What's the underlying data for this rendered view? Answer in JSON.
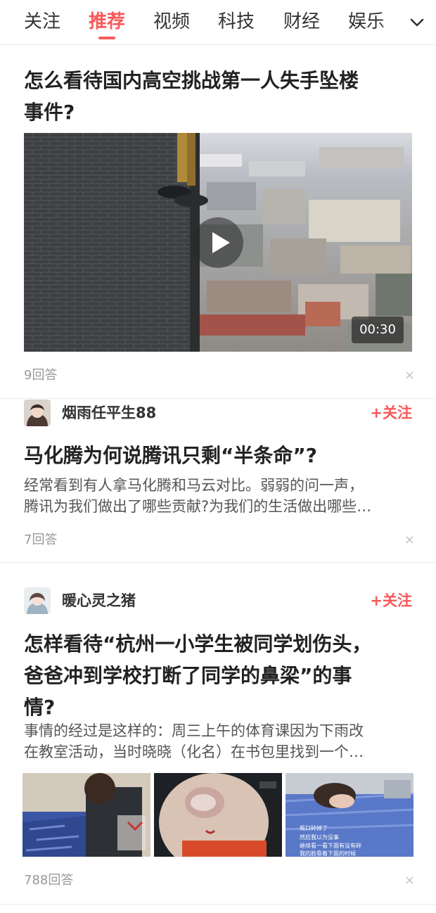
{
  "tabs": [
    {
      "label": "关注",
      "active": false
    },
    {
      "label": "推荐",
      "active": true
    },
    {
      "label": "视频",
      "active": false
    },
    {
      "label": "科技",
      "active": false
    },
    {
      "label": "财经",
      "active": false
    },
    {
      "label": "娱乐",
      "active": false
    }
  ],
  "more_icon": "chevron-down-icon",
  "accent_color": "#f85959",
  "feed": [
    {
      "title_lines": [
        "怎么看待国内高空挑战第一人失手坠楼",
        "事件?"
      ],
      "video": {
        "duration": "00:30",
        "icon": "play-icon"
      },
      "answers": "9回答",
      "dismiss": "×"
    },
    {
      "author": "烟雨任平生88",
      "follow_label": "+关注",
      "title_lines": [
        "马化腾为何说腾讯只剩“半条命”?"
      ],
      "excerpt_lines": [
        "经常看到有人拿马化腾和马云对比。弱弱的问一声，",
        "腾讯为我们做出了哪些贡献?为我们的生活做出哪些…"
      ],
      "answers": "7回答",
      "dismiss": "×"
    },
    {
      "author": "暖心灵之猪",
      "follow_label": "+关注",
      "title_lines": [
        "怎样看待“杭州一小学生被同学划伤头，",
        "爸爸冲到学校打断了同学的鼻梁”的事",
        "情?"
      ],
      "excerpt_lines": [
        "事情的经过是这样的：周三上午的体育课因为下雨改",
        "在教室活动，当时晓晓（化名）在书包里找到一个…"
      ],
      "thumb_captions": [
        "瓶口碎掉了",
        "然后我以为没事",
        "继续看一看下面有没有碎",
        "我的脸靠着下面的时候"
      ],
      "answers": "788回答",
      "dismiss": "×"
    }
  ]
}
